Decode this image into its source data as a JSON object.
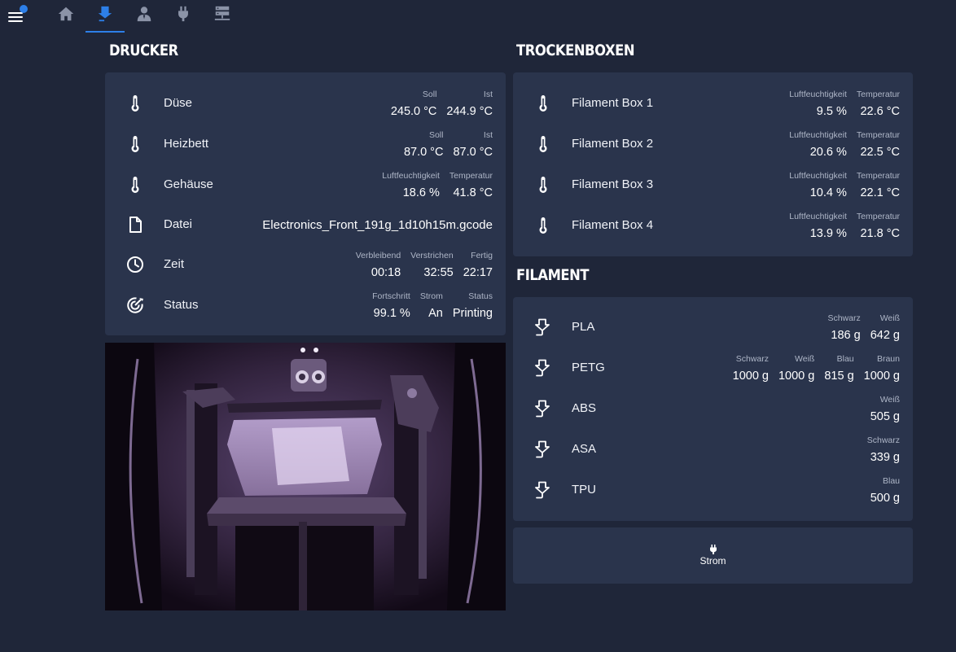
{
  "nav": {
    "tabs": [
      {
        "icon": "home-icon"
      },
      {
        "icon": "filament-icon",
        "active": true
      },
      {
        "icon": "user-icon"
      },
      {
        "icon": "plug-icon"
      },
      {
        "icon": "server-icon"
      }
    ]
  },
  "printer": {
    "title": "DRUCKER",
    "rows": {
      "nozzle": {
        "label": "Düse",
        "target_label": "Soll",
        "target": "245.0 °C",
        "actual_label": "Ist",
        "actual": "244.9 °C"
      },
      "bed": {
        "label": "Heizbett",
        "target_label": "Soll",
        "target": "87.0 °C",
        "actual_label": "Ist",
        "actual": "87.0 °C"
      },
      "enclosure": {
        "label": "Gehäuse",
        "humidity_label": "Luftfeuchtigkeit",
        "humidity": "18.6 %",
        "temp_label": "Temperatur",
        "temp": "41.8 °C"
      },
      "file": {
        "label": "Datei",
        "value": "Electronics_Front_191g_1d10h15m.gcode"
      },
      "time": {
        "label": "Zeit",
        "remaining_label": "Verbleibend",
        "remaining": "00:18",
        "elapsed_label": "Verstrichen",
        "elapsed": "32:55",
        "done_label": "Fertig",
        "done": "22:17"
      },
      "status": {
        "label": "Status",
        "progress_label": "Fortschritt",
        "progress": "99.1 %",
        "power_label": "Strom",
        "power": "An",
        "status_label": "Status",
        "status": "Printing"
      }
    }
  },
  "dryboxes": {
    "title": "TROCKENBOXEN",
    "humidity_label": "Luftfeuchtigkeit",
    "temp_label": "Temperatur",
    "boxes": [
      {
        "name": "Filament Box 1",
        "humidity": "9.5 %",
        "temp": "22.6 °C"
      },
      {
        "name": "Filament Box 2",
        "humidity": "20.6 %",
        "temp": "22.5 °C"
      },
      {
        "name": "Filament Box 3",
        "humidity": "10.4 %",
        "temp": "22.1 °C"
      },
      {
        "name": "Filament Box 4",
        "humidity": "13.9 %",
        "temp": "21.8 °C"
      }
    ]
  },
  "filament": {
    "title": "FILAMENT",
    "types": [
      {
        "name": "PLA",
        "spools": [
          {
            "color": "Schwarz",
            "weight": "186 g"
          },
          {
            "color": "Weiß",
            "weight": "642 g"
          }
        ]
      },
      {
        "name": "PETG",
        "spools": [
          {
            "color": "Schwarz",
            "weight": "1000 g"
          },
          {
            "color": "Weiß",
            "weight": "1000 g"
          },
          {
            "color": "Blau",
            "weight": "815 g"
          },
          {
            "color": "Braun",
            "weight": "1000 g"
          }
        ]
      },
      {
        "name": "ABS",
        "spools": [
          {
            "color": "Weiß",
            "weight": "505 g"
          }
        ]
      },
      {
        "name": "ASA",
        "spools": [
          {
            "color": "Schwarz",
            "weight": "339 g"
          }
        ]
      },
      {
        "name": "TPU",
        "spools": [
          {
            "color": "Blau",
            "weight": "500 g"
          }
        ]
      }
    ]
  },
  "power_button": {
    "label": "Strom"
  },
  "colors": {
    "background": "#1f2639",
    "card": "#2a344c",
    "accent": "#2d7fe8"
  }
}
